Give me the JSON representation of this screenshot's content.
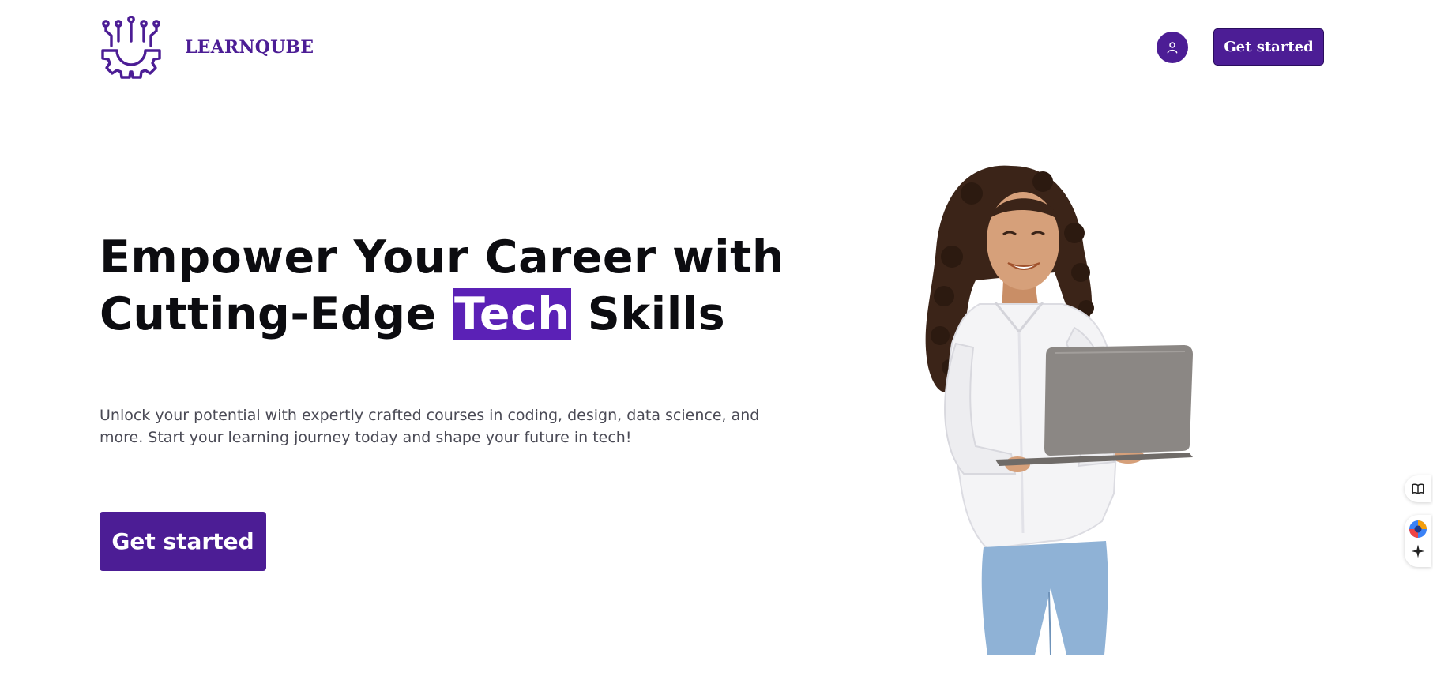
{
  "header": {
    "brand": "LEARNQUBE",
    "cta_label": "Get started",
    "account_icon": "user-icon",
    "logo_icon": "circuit-gear-icon"
  },
  "hero": {
    "title_line1": "Empower Your Career with",
    "title_line2_before": "Cutting-Edge ",
    "title_highlight": "Tech",
    "title_line2_after": " Skills",
    "subtitle": "Unlock your potential with expertly crafted courses in coding, design, data science, and more. Start your learning journey today and shape your future in tech!",
    "cta_label": "Get started",
    "image": "woman-with-laptop-photo"
  },
  "side_widget": {
    "items": [
      "book-icon",
      "globe-icon",
      "sparkle-icon"
    ]
  },
  "colors": {
    "brand": "#4c1d95",
    "highlight": "#5b21b6",
    "text": "#0c0c10",
    "muted": "#4a4a55"
  }
}
